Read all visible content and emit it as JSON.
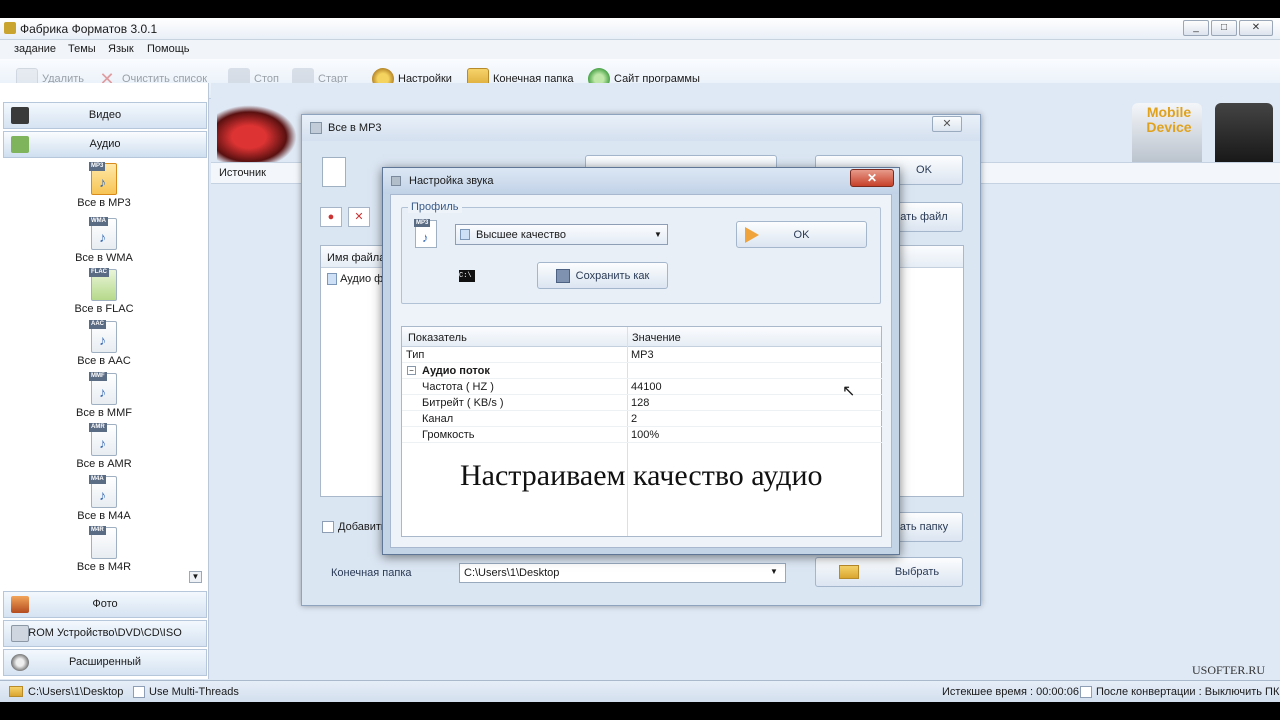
{
  "app": {
    "title": "Фабрика Форматов 3.0.1",
    "window_buttons": [
      "_",
      "□",
      "✕"
    ]
  },
  "menu": [
    "задание",
    "Темы",
    "Язык",
    "Помощь"
  ],
  "toolbar": {
    "delete": "Удалить",
    "clear_list": "Очистить список",
    "stop": "Стоп",
    "start": "Старт",
    "settings": "Настройки",
    "output_folder": "Конечная папка",
    "website": "Сайт программы"
  },
  "sidebar": {
    "categories": {
      "video": "Видео",
      "audio": "Аудио",
      "photo": "Фото",
      "rom": "ROM Устройство\\DVD\\CD\\ISO",
      "advanced": "Расширенный"
    },
    "formats": [
      {
        "label": "Все в MP3",
        "tag": "MP3"
      },
      {
        "label": "Все в WMA",
        "tag": "WMA"
      },
      {
        "label": "Все в FLAC",
        "tag": "FLAC"
      },
      {
        "label": "Все в AAC",
        "tag": "AAC"
      },
      {
        "label": "Все в MMF",
        "tag": "MMF"
      },
      {
        "label": "Все в AMR",
        "tag": "AMR"
      },
      {
        "label": "Все в M4A",
        "tag": "M4A"
      },
      {
        "label": "Все в M4R",
        "tag": "M4R"
      }
    ]
  },
  "main": {
    "source_label": "Источник",
    "mobile_device_text": "Mobile Device"
  },
  "dialog_mp3": {
    "title": "Все в MP3",
    "close": "✕",
    "ok_label": "OK",
    "add_file_label": "ать файл",
    "file_column": "Имя файла",
    "file_row": "Аудио ф",
    "add_checkbox": "Добавить",
    "add_folder_label": "ать папку",
    "output_folder_label": "Конечная папка",
    "output_folder_value": "C:\\Users\\1\\Desktop",
    "browse_label": "Выбрать"
  },
  "dialog_sound": {
    "title": "Настройка звука",
    "close": "✕",
    "profile_label": "Профиль",
    "profile_value": "Высшее качество",
    "ok_label": "OK",
    "save_as_label": "Сохранить как",
    "cmd_text": "C:\\",
    "grid": {
      "col_param": "Показатель",
      "col_value": "Значение",
      "rows": [
        {
          "name": "Тип",
          "value": "MP3"
        },
        {
          "name": "Аудио поток",
          "value": "",
          "group": true
        },
        {
          "name": "Частота ( HZ )",
          "value": "44100"
        },
        {
          "name": "Битрейт ( KB/s )",
          "value": "128"
        },
        {
          "name": "Канал",
          "value": "2"
        },
        {
          "name": "Громкость",
          "value": "100%"
        }
      ]
    },
    "overlay_text": "Настраиваем качество аудио"
  },
  "watermark": "USOFTER.RU",
  "statusbar": {
    "path": "C:\\Users\\1\\Desktop",
    "multithreads": "Use Multi-Threads",
    "elapsed": "Истекшее время : 00:00:06",
    "after_convert": "После конвертации : Выключить ПК"
  }
}
